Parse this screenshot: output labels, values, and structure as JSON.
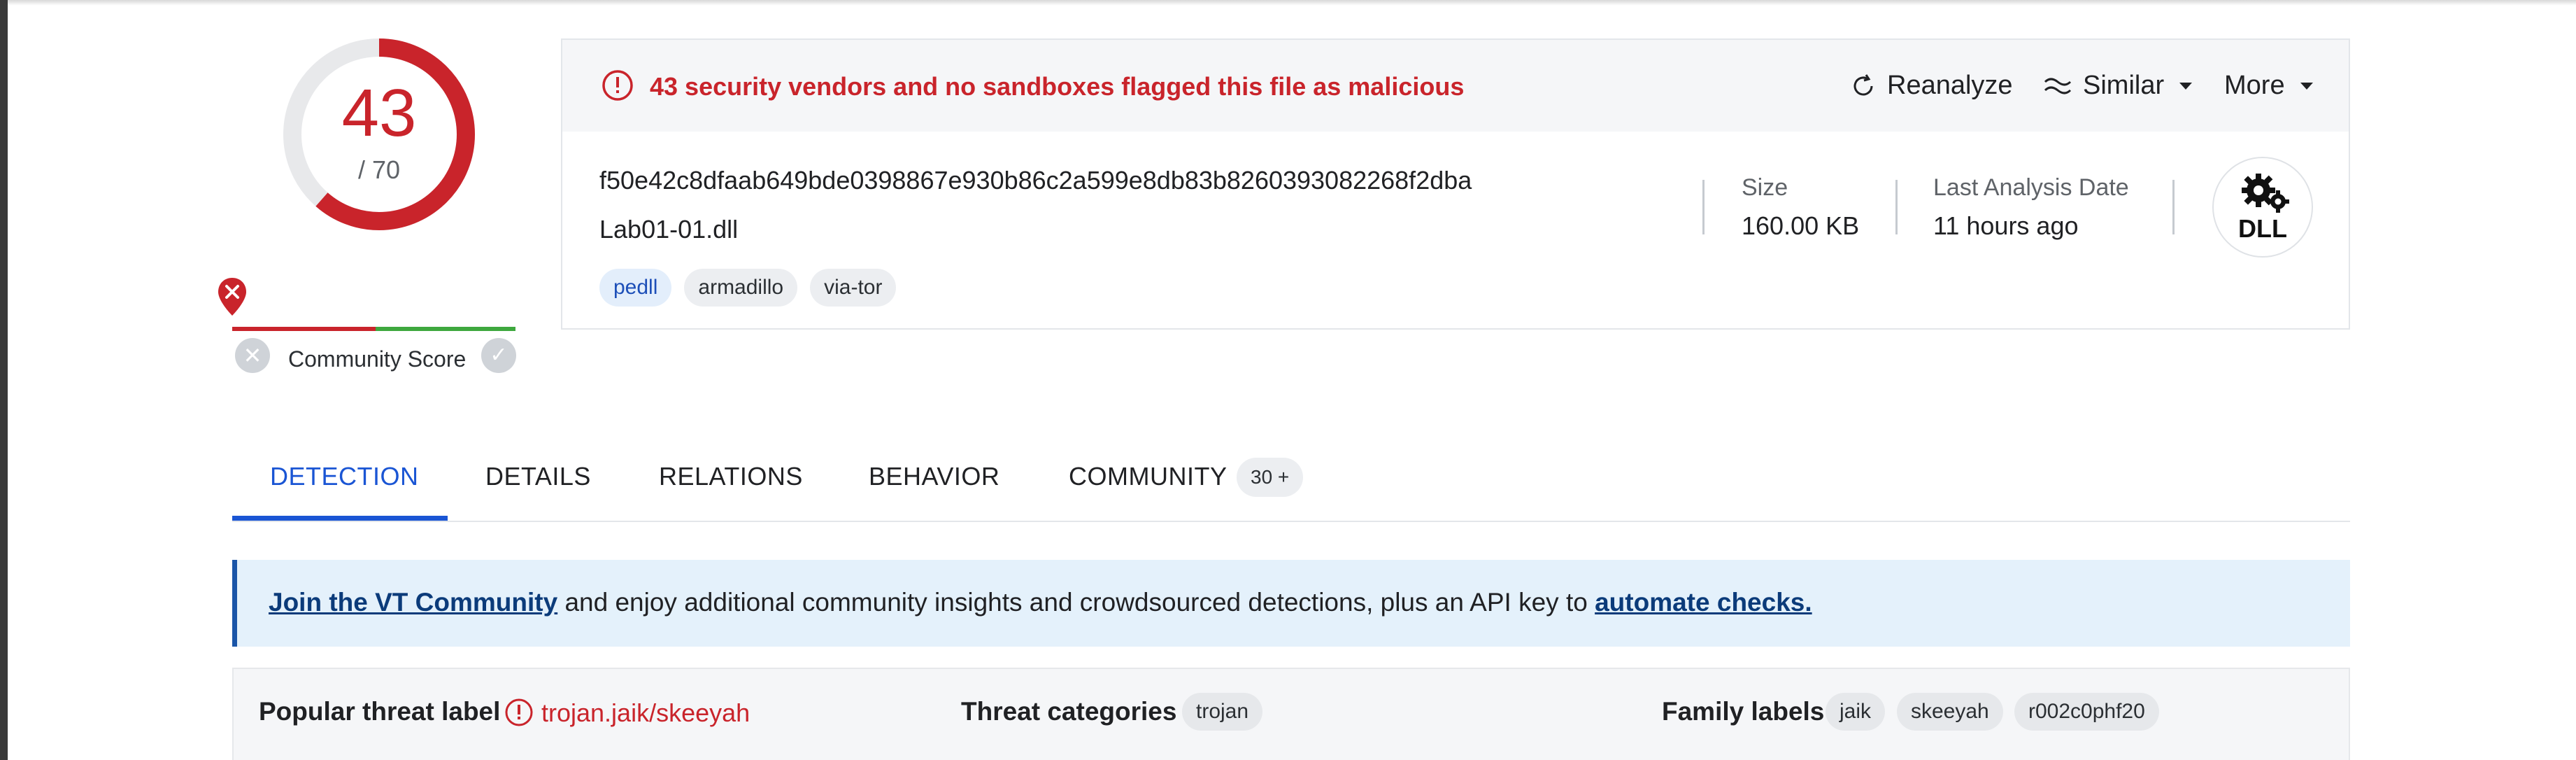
{
  "score": {
    "detections": "43",
    "total": "/ 70",
    "accent": "#c9242b"
  },
  "community": {
    "label": "Community Score"
  },
  "alert": {
    "text": "43 security vendors and no sandboxes flagged this file as malicious"
  },
  "actions": {
    "reanalyze": "Reanalyze",
    "similar": "Similar",
    "more": "More"
  },
  "file": {
    "hash": "f50e42c8dfaab649bde0398867e930b86c2a599e8db83b8260393082268f2dba",
    "name": "Lab01-01.dll",
    "tags": [
      "pedll",
      "armadillo",
      "via-tor"
    ],
    "size_label": "Size",
    "size_value": "160.00 KB",
    "date_label": "Last Analysis Date",
    "date_value": "11 hours ago",
    "type_icon_text": "DLL"
  },
  "tabs": [
    {
      "label": "DETECTION"
    },
    {
      "label": "DETAILS"
    },
    {
      "label": "RELATIONS"
    },
    {
      "label": "BEHAVIOR"
    },
    {
      "label": "COMMUNITY"
    }
  ],
  "community_badge": "30 +",
  "banner": {
    "link1": "Join the VT Community",
    "middle": " and enjoy additional community insights and crowdsourced detections, plus an API key to ",
    "link2": "automate checks."
  },
  "threat": {
    "popular_label": "Popular threat label",
    "popular_value": "trojan.jaik/skeeyah",
    "categories_label": "Threat categories",
    "categories": [
      "trojan"
    ],
    "family_label": "Family labels",
    "families": [
      "jaik",
      "skeeyah",
      "r002c0phf20"
    ]
  }
}
